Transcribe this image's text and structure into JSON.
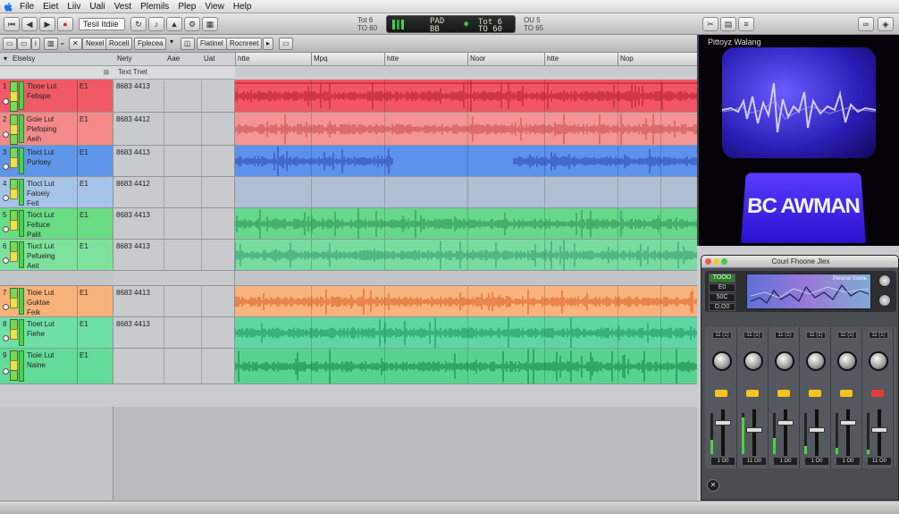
{
  "menubar": {
    "items": [
      "File",
      "Eiet",
      "Liiv",
      "Uali",
      "Vest",
      "Plemils",
      "Plep",
      "View",
      "Help"
    ]
  },
  "toolbar": {
    "track_field": "Tesil Itdiie",
    "lcd": {
      "left": "PAD",
      "left2": "BB",
      "right_top": "Tot 6",
      "right_bot": "TO 60"
    },
    "right_labels": [
      "Tot 6",
      "TO 60",
      "OU 5",
      "TO 65"
    ]
  },
  "toolbar2": {
    "buttons": [
      "Nexel",
      "Rocell",
      "Fplecea",
      "Fiatinel",
      "Rocnreet"
    ]
  },
  "track_list": {
    "header_label": "Elselsy",
    "columns": [
      "Nety",
      "Aae",
      "Uat"
    ],
    "subheader": "Text Tnet",
    "ruler_marks": [
      "htte",
      "Mpq",
      "htte",
      "Noor",
      "htte",
      "Nop"
    ]
  },
  "tracks": [
    {
      "num": "1",
      "name": "Tlooe Lut\nFebspe",
      "ch": "E1",
      "code": "8683 4413",
      "color": "#f05a64",
      "lane": "#f25563",
      "wave": "#b0172a"
    },
    {
      "num": "2",
      "name": "Goie Lut\nPlefoping\nAeih",
      "ch": "E1",
      "code": "8683 4412",
      "color": "#f48a8a",
      "lane": "#f49494",
      "wave": "#c44444"
    },
    {
      "num": "3",
      "name": "Tioct Lut\nPurloey",
      "ch": "E1",
      "code": "8683 4413",
      "color": "#5f96ea",
      "lane": "#5c92ec",
      "wave": "#2a3fb0"
    },
    {
      "num": "4",
      "name": "Tloct Lut\nFaloeiy\nFeit",
      "ch": "E1",
      "code": "8683 4412",
      "color": "#a8c3e8",
      "lane": "#b1bfd4",
      "wave": "#6b7d99"
    },
    {
      "num": "5",
      "name": "Tioct Lut\nFeltuce\nPalit",
      "ch": "E1",
      "code": "8683 4413",
      "color": "#69dc85",
      "lane": "#67d78c",
      "wave": "#1f8a4a"
    },
    {
      "num": "6",
      "name": "Tiuct Lut\nPefueing\nAeit",
      "ch": "E1",
      "code": "8683 4413",
      "color": "#7fe29c",
      "lane": "#78dba0",
      "wave": "#27956a"
    },
    {
      "num": "7",
      "name": "Tioie Lut\nGuktae\nFeik",
      "ch": "E1",
      "code": "8683 4413",
      "color": "#f7b27a",
      "lane": "#f9b37d",
      "wave": "#d9561c"
    },
    {
      "num": "8",
      "name": "Tioet Lut\nFiehe",
      "ch": "E1",
      "code": "8683 4413",
      "color": "#6ee0a6",
      "lane": "#5fd7a5",
      "wave": "#0f8d55"
    },
    {
      "num": "9",
      "name": "Tioie Lut\nNaine",
      "ch": "E1",
      "code": "",
      "color": "#62dc98",
      "lane": "#56d48f",
      "wave": "#0c7a3a"
    }
  ],
  "video": {
    "title": "Pittoyz Walang",
    "banner": "BC AWMAN"
  },
  "plugin": {
    "title": "Couri Fhoone Jlex",
    "buttons": [
      "TOOO",
      "E0",
      "50C",
      "O.O0"
    ],
    "display_label": "Pelonal\nSowie",
    "strip_labels": [
      "11 (1)",
      "11 (1)",
      "11 (1)",
      "11 (1)",
      "11 (1)",
      "11 (1)"
    ],
    "strip_values": [
      "1 O0",
      "11 O0",
      "1 O0",
      "1 O0",
      "1 O0",
      "11 O0"
    ],
    "led_colors": [
      "#f4c51d",
      "#f4c51d",
      "#f4c51d",
      "#f4c51d",
      "#f4c51d",
      "#e83c3c"
    ],
    "meter_levels": [
      0.35,
      0.9,
      0.4,
      0.2,
      0.15,
      0.1
    ]
  }
}
